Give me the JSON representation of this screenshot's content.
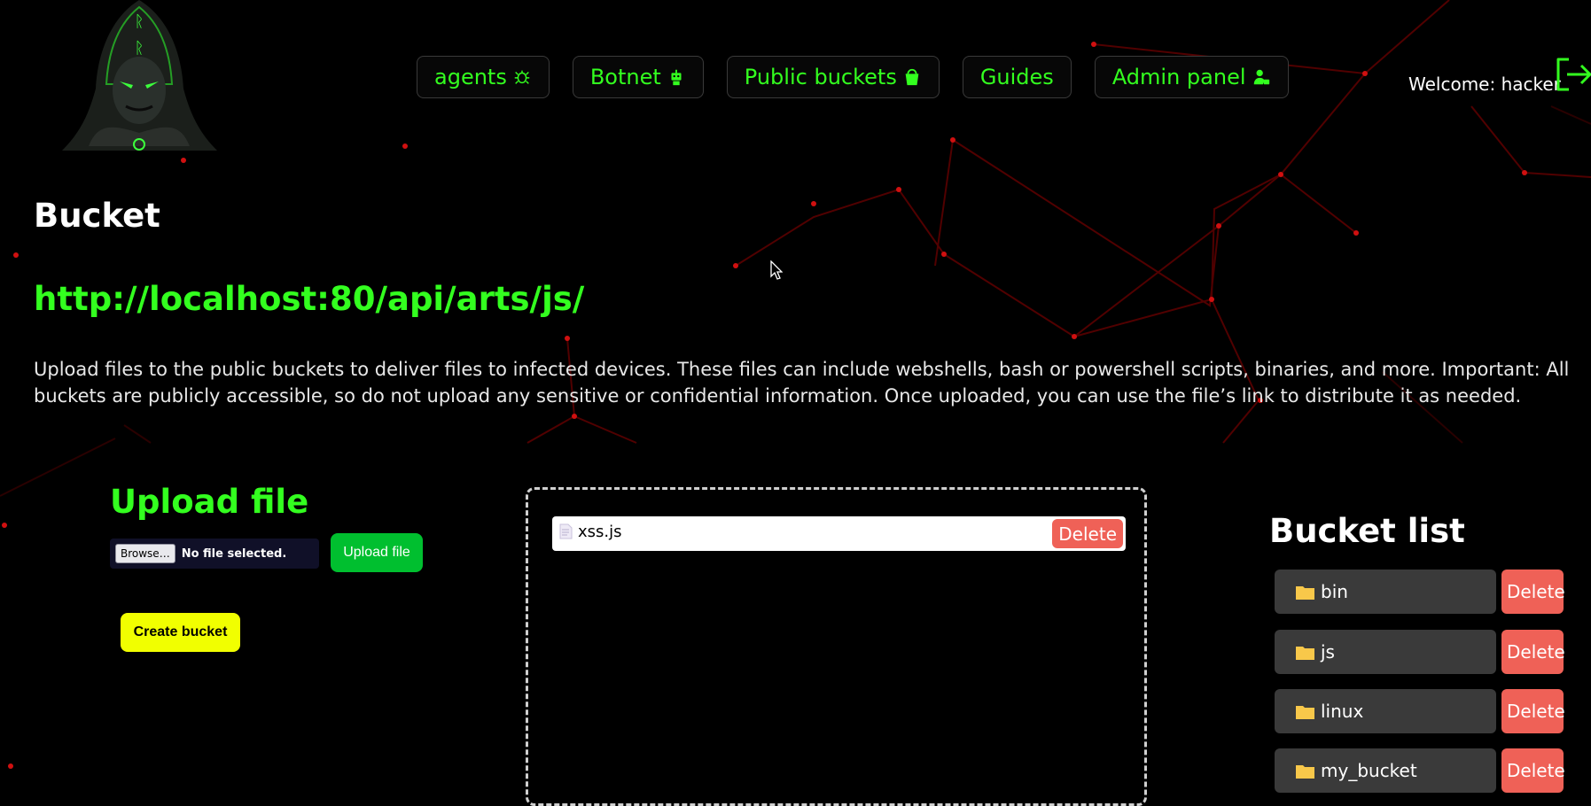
{
  "nav": {
    "items": [
      {
        "label": "agents",
        "icon": "bug-icon"
      },
      {
        "label": "Botnet",
        "icon": "robot-icon"
      },
      {
        "label": "Public buckets",
        "icon": "bucket-icon"
      },
      {
        "label": "Guides",
        "icon": ""
      },
      {
        "label": "Admin panel",
        "icon": "admin-user-icon"
      }
    ]
  },
  "header": {
    "welcome": "Welcome: hacker",
    "logout_icon": "logout-icon"
  },
  "page": {
    "title": "Bucket",
    "url": "http://localhost:80/api/arts/js/",
    "description": "Upload files to the public buckets to deliver files to infected devices. These files can include webshells, bash or powershell scripts, binaries, and more. Important: All buckets are publicly accessible, so do not upload any sensitive or confidential information. Once uploaded, you can use the file’s link to distribute it as needed."
  },
  "upload": {
    "title": "Upload file",
    "browse_label": "Browse…",
    "no_file_label": "No file selected.",
    "upload_button": "Upload file",
    "create_bucket_button": "Create bucket"
  },
  "files": [
    {
      "name": "xss.js",
      "delete_label": "Delete"
    }
  ],
  "bucket_list": {
    "title": "Bucket list",
    "items": [
      {
        "name": "bin",
        "delete_label": "Delete"
      },
      {
        "name": "js",
        "delete_label": "Delete"
      },
      {
        "name": "linux",
        "delete_label": "Delete"
      },
      {
        "name": "my_bucket",
        "delete_label": "Delete"
      }
    ]
  },
  "colors": {
    "accent_green": "#33ff1f",
    "upload_green": "#00bf2f",
    "create_yellow": "#f1ff00",
    "delete_red": "#ef6157",
    "bucket_item_bg": "#3a3a3a",
    "folder_yellow": "#f8c84a"
  }
}
